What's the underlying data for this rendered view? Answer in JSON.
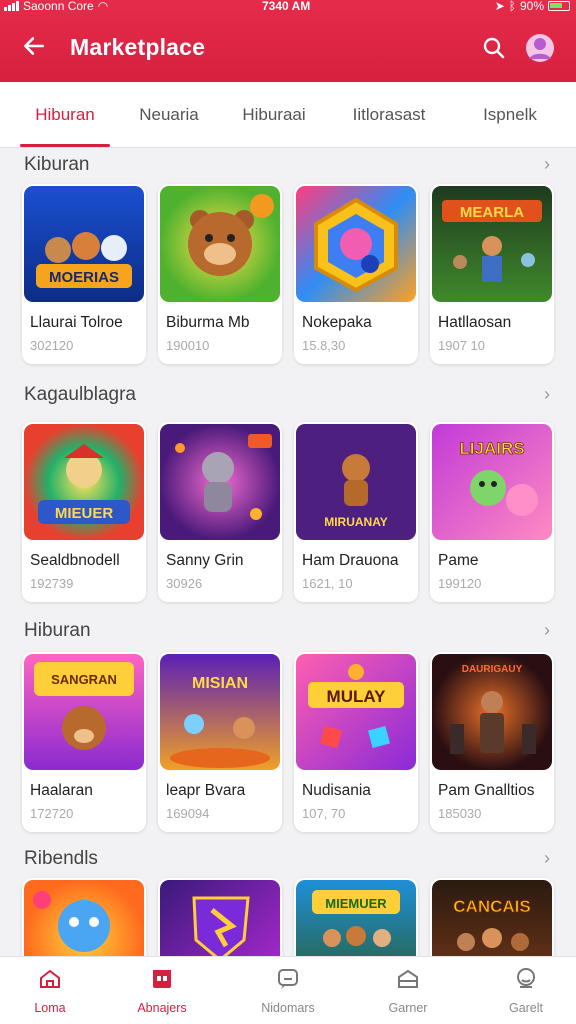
{
  "status_bar": {
    "carrier": "Saoonn Core",
    "time": "7340 AM",
    "battery": "90%"
  },
  "header": {
    "title": "Marketplace",
    "accent_color": "#d71f3f",
    "icons": [
      "back-arrow-icon",
      "search-icon",
      "profile-icon"
    ]
  },
  "tabs": [
    {
      "label": "Hiburan",
      "active": true
    },
    {
      "label": "Neuaria",
      "active": false
    },
    {
      "label": "Hiburaai",
      "active": false
    },
    {
      "label": "Iitlorasast",
      "active": false
    },
    {
      "label": "Ispnelk",
      "active": false
    }
  ],
  "sections": [
    {
      "title": "Kiburan",
      "more": "›",
      "items": [
        {
          "name": "Llaurai Tolroe",
          "meta": "302120",
          "art": "MOERIAS"
        },
        {
          "name": "Biburma Mb",
          "meta": "190010",
          "art": ""
        },
        {
          "name": "Nokepaka",
          "meta": "15.8,30",
          "art": ""
        },
        {
          "name": "Hatllaosan",
          "meta": "1907 10",
          "art": "MEARLA"
        }
      ]
    },
    {
      "title": "Kagaulblagra",
      "more": "›",
      "items": [
        {
          "name": "Sealdbnodell",
          "meta": "192739",
          "art": "MIEUER"
        },
        {
          "name": "Sanny Grin",
          "meta": "30926",
          "art": ""
        },
        {
          "name": "Ham Drauona",
          "meta": "1621, 10",
          "art": "MIRUANAY"
        },
        {
          "name": "Pame",
          "meta": "199120",
          "art": "LIJAIRS"
        }
      ]
    },
    {
      "title": "Hiburan",
      "more": "›",
      "items": [
        {
          "name": "Haalaran",
          "meta": "172720",
          "art": "SANGRAN"
        },
        {
          "name": "leapr Bvara",
          "meta": "169094",
          "art": "MISIAN"
        },
        {
          "name": "Nudisania",
          "meta": "107, 70",
          "art": "MULAY"
        },
        {
          "name": "Pam Gnalltios",
          "meta": "185030",
          "art": "DAURIGAUY"
        }
      ]
    },
    {
      "title": "Ribendls",
      "more": "›",
      "items": [
        {
          "name": "",
          "meta": "",
          "art": ""
        },
        {
          "name": "",
          "meta": "",
          "art": ""
        },
        {
          "name": "",
          "meta": "",
          "art": "MIEMUER"
        },
        {
          "name": "",
          "meta": "",
          "art": "CANCAIS"
        }
      ]
    }
  ],
  "bottom_nav": [
    {
      "label": "Loma",
      "icon": "home-icon",
      "active": true
    },
    {
      "label": "Abnajers",
      "icon": "store-icon",
      "active": true
    },
    {
      "label": "Nidomars",
      "icon": "chat-icon",
      "active": false
    },
    {
      "label": "Garner",
      "icon": "box-icon",
      "active": false
    },
    {
      "label": "Garelt",
      "icon": "user-icon",
      "active": false
    }
  ]
}
